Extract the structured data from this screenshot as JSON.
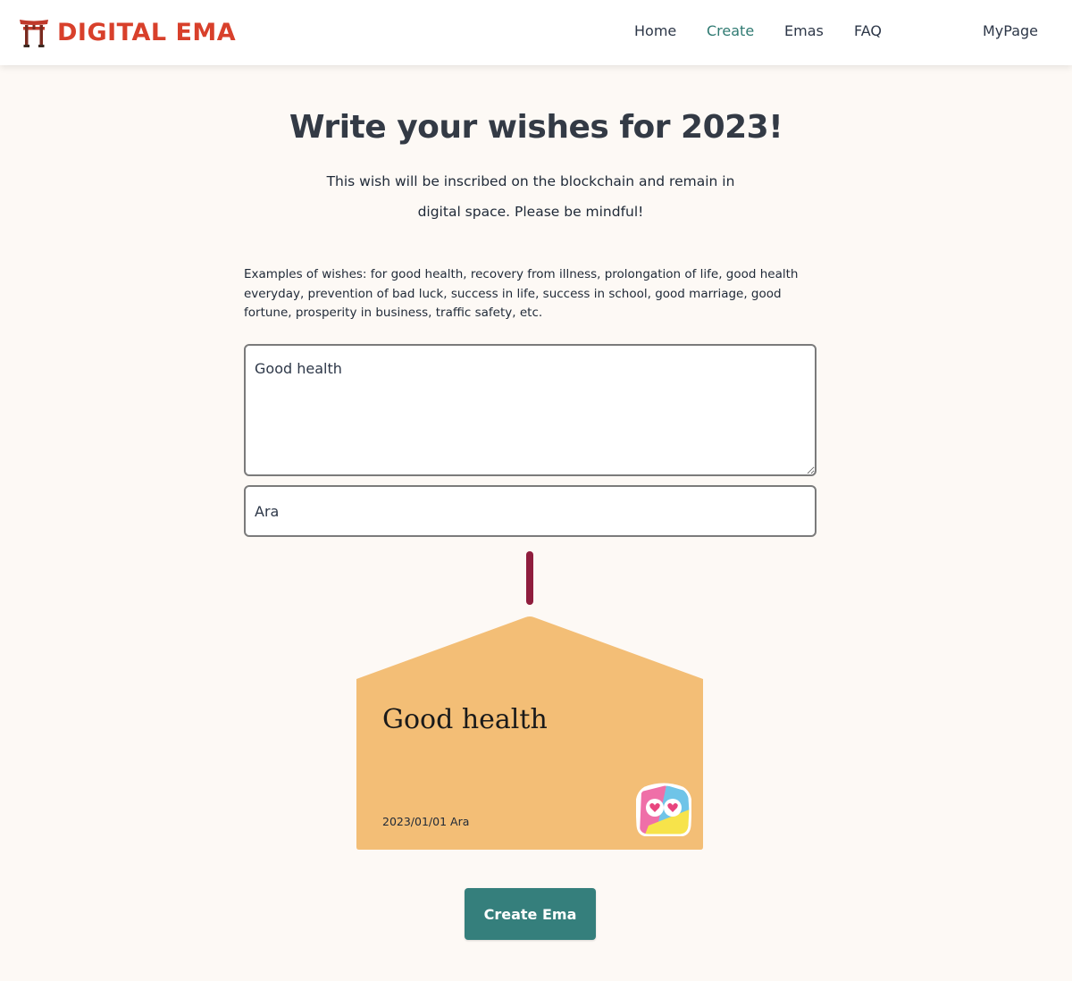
{
  "header": {
    "logo_text": "DIGITAL EMA",
    "logo_icon": "torii-gate-icon",
    "nav": {
      "home": "Home",
      "create": "Create",
      "emas": "Emas",
      "faq": "FAQ",
      "mypage": "MyPage"
    },
    "active_nav": "Create"
  },
  "main": {
    "title": "Write your wishes for 2023!",
    "subtitle": "This wish will be inscribed on the blockchain and remain in digital space. Please be mindful!",
    "examples": "Examples of wishes: for good health, recovery from illness, prolongation of life, good health everyday, prevention of bad luck, success in life, success in school, good marriage, good fortune, prosperity in business, traffic safety, etc.",
    "wish_input": {
      "value": "Good health"
    },
    "name_input": {
      "value": "Ara"
    }
  },
  "ema": {
    "wish": "Good health",
    "date": "2023/01/01",
    "name": "Ara",
    "meta": "2023/01/01 Ara",
    "badge_icon": "heart-eyes-mascot-icon"
  },
  "actions": {
    "create_label": "Create Ema"
  },
  "colors": {
    "brand_red": "#d8402b",
    "accent_teal": "#357f7c",
    "nav_active": "#2f7a72",
    "ema_wood": "#f3be76",
    "ema_string": "#8f1d3d",
    "background": "#fdf9f5"
  }
}
